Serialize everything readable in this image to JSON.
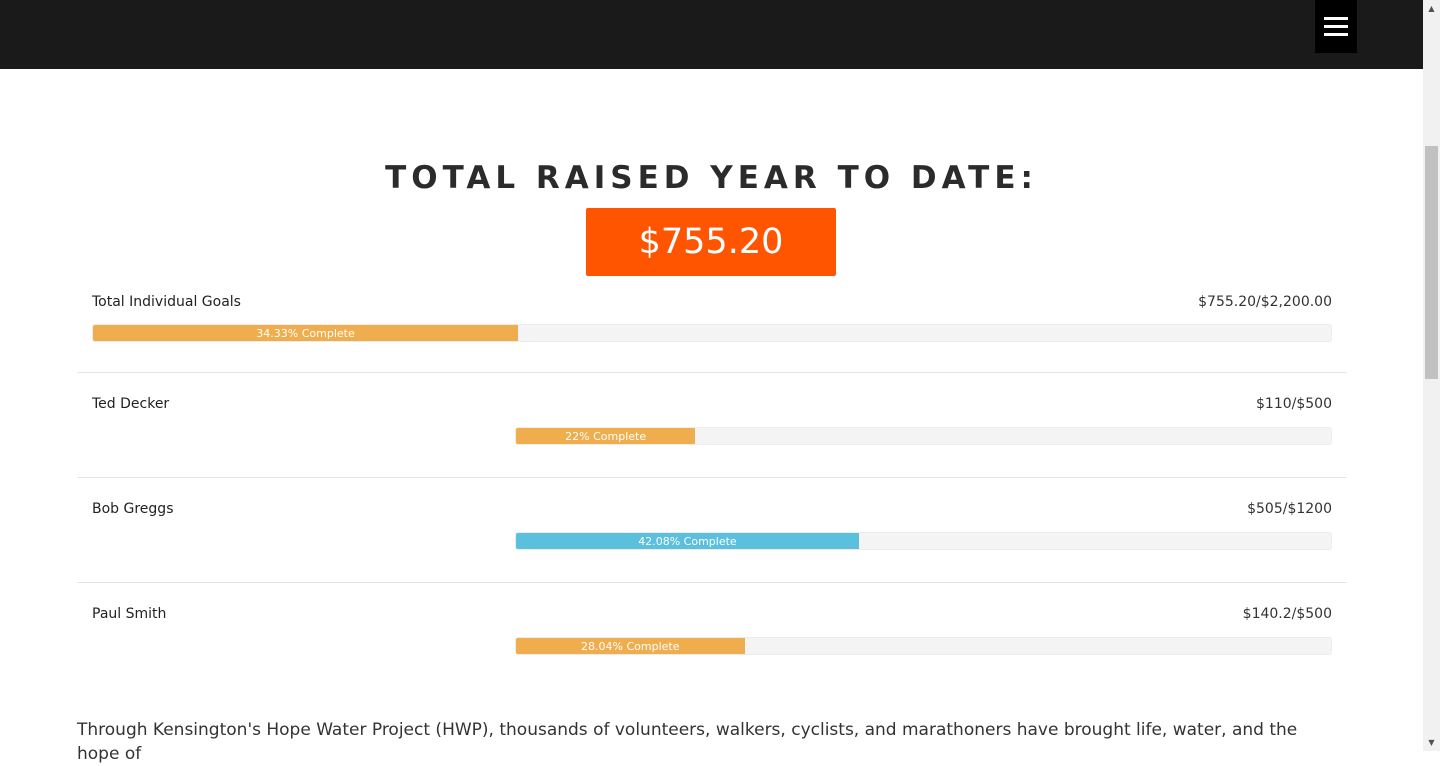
{
  "menu": {
    "icon": "hamburger-menu-icon"
  },
  "summary": {
    "heading": "TOTAL RAISED YEAR TO DATE:",
    "total": "$755.20",
    "accent": "#ff5500"
  },
  "goals": {
    "label": "Total Individual Goals",
    "amount": "$755.20/$2,200.00",
    "progress_text": "34.33% Complete",
    "progress_percent": 34.33,
    "color": "#f0ad4e"
  },
  "participants": [
    {
      "name": "Ted Decker",
      "amount": "$110/$500",
      "progress_text": "22% Complete",
      "progress_percent": 22,
      "color": "#f0ad4e"
    },
    {
      "name": "Bob Greggs",
      "amount": "$505/$1200",
      "progress_text": "42.08% Complete",
      "progress_percent": 42.08,
      "color": "#5bc0de"
    },
    {
      "name": "Paul Smith",
      "amount": "$140.2/$500",
      "progress_text": "28.04% Complete",
      "progress_percent": 28.04,
      "color": "#f0ad4e"
    }
  ],
  "body_text": "Through Kensington's Hope Water Project (HWP), thousands of volunteers, walkers, cyclists, and marathoners have brought life, water, and the hope of"
}
